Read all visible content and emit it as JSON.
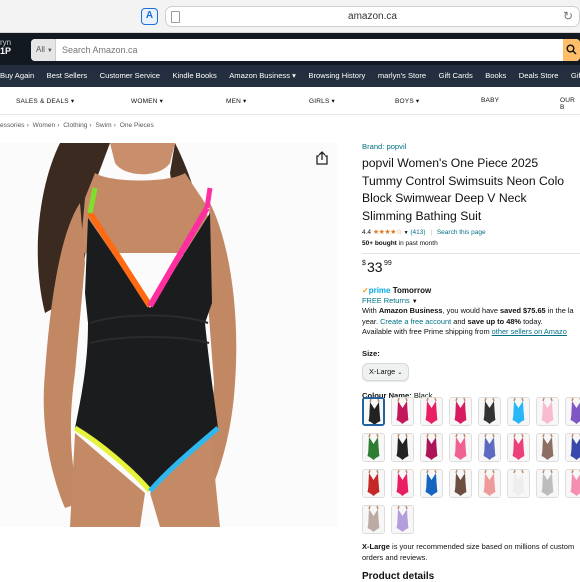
{
  "browser": {
    "url": "amazon.ca",
    "extension_label": "A"
  },
  "header": {
    "deliver_line1": "ryn",
    "deliver_line2": "1P",
    "search_category": "All",
    "search_placeholder": "Search Amazon.ca",
    "colors": {
      "nav_dark": "#131921",
      "nav_sub": "#232f3e",
      "search_button": "#febd69"
    }
  },
  "nav_links": [
    "Buy Again",
    "Best Sellers",
    "Customer Service",
    "Kindle Books",
    "Amazon Business ▾",
    "Browsing History",
    "marlyn's Store",
    "Gift Cards",
    "Books",
    "Deals Store",
    "Gift Ide"
  ],
  "categories": [
    "SALES & DEALS ▾",
    "WOMEN ▾",
    "MEN ▾",
    "GIRLS ▾",
    "BOYS ▾",
    "BABY",
    "OUR B"
  ],
  "breadcrumb": [
    "essories",
    "Women",
    "Clothing",
    "Swim",
    "One Pieces"
  ],
  "product": {
    "brand": "Brand: popvil",
    "title_lines": [
      "popvil Women's One Piece 2025",
      "Tummy Control Swimsuits Neon Colo",
      "Block Swimwear Deep V Neck",
      "Slimming Bathing Suit"
    ],
    "rating": "4.4",
    "stars": "★★★★☆",
    "rating_count": "(413)",
    "search_link": "Search this page",
    "bought_bold": "50+ bought",
    "bought_rest": " in past month",
    "price_symbol": "$",
    "price_whole": "33",
    "price_fraction": "99",
    "prime_check": "✓",
    "prime_word": "prime",
    "prime_day": "Tomorrow",
    "free_returns": "FREE Returns",
    "biz_line1_a": "With ",
    "biz_line1_b": "Amazon Business",
    "biz_line1_c": ", you would have ",
    "biz_line1_d": "saved $75.65",
    "biz_line1_e": " in the la",
    "biz_line2_a": "year. ",
    "biz_line2_b": "Create a free account",
    "biz_line2_c": " and ",
    "biz_line2_d": "save up to 48%",
    "biz_line2_e": " today.",
    "biz_line3_a": "Available with free Prime shipping from ",
    "biz_line3_b": "other sellers on Amazo",
    "size_label": "Size:",
    "size_value": "X-Large",
    "colour_label": "Colour Name:",
    "colour_value": "Black",
    "fit_bold": "X-Large",
    "fit_rest": " is your recommended size based on millions of custom",
    "fit_line2": "orders and reviews.",
    "details_heading": "Product details"
  },
  "swatch_colors": [
    [
      "#222222",
      "#c2185b",
      "#e91e63",
      "#d81b60",
      "#333333",
      "#29b6f6",
      "#f8bbd0",
      "#7e57c2"
    ],
    [
      "#2e7d32",
      "#222222",
      "#ad1457",
      "#f06292",
      "#5c6bc0",
      "#ec407a",
      "#8d6e63",
      "#3949ab"
    ],
    [
      "#c62828",
      "#e91e63",
      "#1565c0",
      "#6d4c41",
      "#ef9a9a",
      "#eeeeee",
      "#bdbdbd",
      "#f48fb1"
    ],
    [
      "#bcaaa4",
      "#b39ddb"
    ]
  ]
}
